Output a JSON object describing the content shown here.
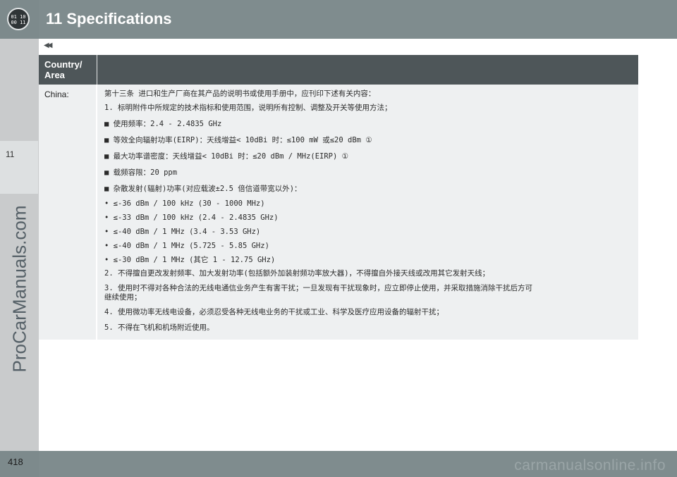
{
  "header": {
    "title": "11 Specifications",
    "logo_text": "01 10 00 11"
  },
  "sidebar": {
    "chapter": "11",
    "watermark": "ProCarManuals.com"
  },
  "page_number": "418",
  "nav": {
    "back_icon": "double-chevron-left-icon",
    "back_symbol": "◀◀"
  },
  "footer": {
    "watermark": "carmanualsonline.info"
  },
  "table": {
    "header_country": "Country/\nArea",
    "row_country": "China:",
    "lines": [
      "第十三条  进口和生产厂商在其产品的说明书或使用手册中，应刊印下述有关内容：",
      "1. 标明附件中所规定的技术指标和使用范围，说明所有控制、调整及开关等使用方法；",
      "■  使用频率：2.4 - 2.4835 GHz",
      "■  等效全向辐射功率(EIRP)：天线增益< 10dBi 时：≤100 mW 或≤20 dBm  ①",
      "■  最大功率谱密度：天线增益< 10dBi 时：≤20 dBm / MHz(EIRP) ①",
      "■  载频容限：20 ppm",
      "■  杂散发射(辐射)功率(对应载波±2.5 倍信道带宽以外)：",
      "•   ≤-36 dBm / 100 kHz (30 - 1000 MHz)",
      "•   ≤-33 dBm / 100 kHz (2.4 - 2.4835 GHz)",
      "•   ≤-40 dBm / 1 MHz (3.4 - 3.53 GHz)",
      "•   ≤-40 dBm / 1 MHz (5.725 - 5.85 GHz)",
      "•   ≤-30 dBm / 1 MHz (其它 1 - 12.75 GHz)",
      "2. 不得擅自更改发射频率、加大发射功率(包括额外加装射频功率放大器)，不得擅自外接天线或改用其它发射天线；",
      "3. 使用时不得对各种合法的无线电通信业务产生有害干扰；一旦发现有干扰现象时，应立即停止使用，并采取措施消除干扰后方可\n继续使用；",
      "4. 使用微功率无线电设备，必须忍受各种无线电业务的干扰或工业、科学及医疗应用设备的辐射干扰；",
      "5. 不得在飞机和机场附近使用。"
    ]
  }
}
